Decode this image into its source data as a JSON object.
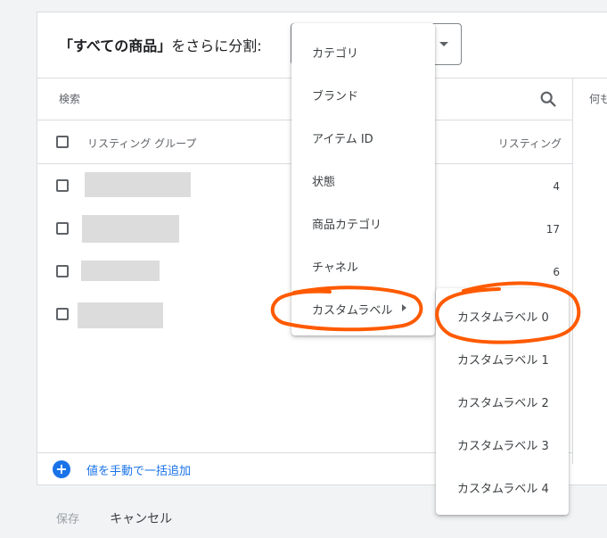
{
  "header": {
    "title_bracketed": "「すべての商品」",
    "title_suffix": "をさらに分割:"
  },
  "search": {
    "placeholder": "検索"
  },
  "right_column": {
    "truncated_text": "何も"
  },
  "table": {
    "header_label": "リスティング グループ",
    "header_count": "リスティング",
    "rows": [
      {
        "count": "4"
      },
      {
        "count": "17"
      },
      {
        "count": "6"
      },
      {
        "count": ""
      }
    ]
  },
  "footer": {
    "add_label": "値を手動で一括追加",
    "add_icon": "+"
  },
  "actions": {
    "save": "保存",
    "cancel": "キャンセル"
  },
  "menu": {
    "items": [
      "カテゴリ",
      "ブランド",
      "アイテム ID",
      "状態",
      "商品カテゴリ",
      "チャネル",
      "カスタムラベル"
    ]
  },
  "submenu": {
    "items": [
      "カスタムラベル 0",
      "カスタムラベル 1",
      "カスタムラベル 2",
      "カスタムラベル 3",
      "カスタムラベル 4"
    ]
  },
  "colors": {
    "accent": "#1a73e8",
    "annotation": "#ff5a00"
  }
}
